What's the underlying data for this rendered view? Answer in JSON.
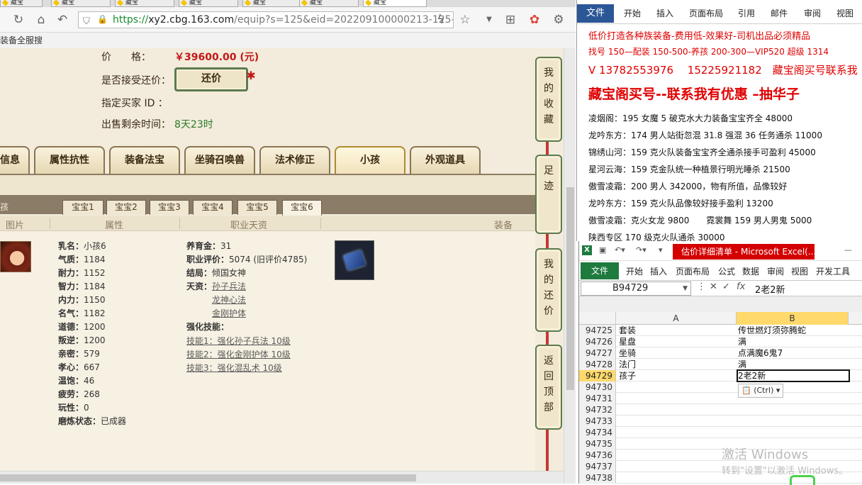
{
  "browser": {
    "tabs": [
      "藏宝",
      "藏宝",
      "藏宝",
      "藏宝",
      "藏宝",
      "藏宝",
      "藏宝"
    ],
    "url_https": "https://",
    "url_host": "xy2.cbg.163.com",
    "url_rest": "/equip?s=125&eid=202209100000213-125-",
    "bookmark": "装备全服搜"
  },
  "sale": {
    "price_label": "价　　格：",
    "price_value": "￥39600.00 (元)",
    "bargain_label": "是否接受还价：",
    "bargain_button": "还价",
    "buyer_label": "指定买家 ID ：",
    "remaining_label": "出售剩余时间：",
    "remaining_value": "8天23时"
  },
  "category_tabs": [
    "信息",
    "属性抗性",
    "装备法宝",
    "坐骑召唤兽",
    "法术修正",
    "小孩",
    "外观道具"
  ],
  "baby_tabs": [
    "宝宝1",
    "宝宝2",
    "宝宝3",
    "宝宝4",
    "宝宝5",
    "宝宝6"
  ],
  "band2_left": "孩",
  "headers": [
    "图片",
    "属性",
    "职业天资",
    "装备"
  ],
  "child": {
    "attrs": [
      {
        "k": "乳名：",
        "v": "小孩6"
      },
      {
        "k": "气质：",
        "v": "1184"
      },
      {
        "k": "耐力：",
        "v": "1152"
      },
      {
        "k": "智力：",
        "v": "1184"
      },
      {
        "k": "内力：",
        "v": "1150"
      },
      {
        "k": "名气：",
        "v": "1182"
      },
      {
        "k": "道德：",
        "v": "1200"
      },
      {
        "k": "叛逆：",
        "v": "1200"
      },
      {
        "k": "亲密：",
        "v": "579"
      },
      {
        "k": "孝心：",
        "v": "667"
      },
      {
        "k": "温饱：",
        "v": "46"
      },
      {
        "k": "疲劳：",
        "v": "268"
      },
      {
        "k": "玩性：",
        "v": "0"
      },
      {
        "k": "磨炼状态：",
        "v": "已成器"
      }
    ],
    "support_money": {
      "k": "养育金：",
      "v": "31"
    },
    "career_score": {
      "k": "职业评价：",
      "v": "5074 (旧评价4785)"
    },
    "ending": {
      "k": "结局：",
      "v": "倾国女神"
    },
    "talent_label": "天资：",
    "talents": [
      "孙子兵法",
      "龙神心法",
      "金刚护体"
    ],
    "skills_label": "强化技能：",
    "skills": [
      "技能1：强化孙子兵法 10级",
      "技能2：强化金刚护体 10级",
      "技能3：强化混乱术 10级"
    ]
  },
  "side_buttons": [
    [
      "我",
      "的",
      "收",
      "藏"
    ],
    [
      "足",
      "迹"
    ],
    [
      "我",
      "的",
      "还",
      "价"
    ],
    [
      "返",
      "回",
      "顶",
      "部"
    ]
  ],
  "word": {
    "menu": [
      "开始",
      "插入",
      "页面布局",
      "引用",
      "邮件",
      "审阅",
      "视图"
    ],
    "file": "文件",
    "lines": [
      {
        "t": "低价打造各种族装备-费用低-效果好-司机出品必须精品",
        "cls": "red"
      },
      {
        "t": "找号 150—配装 150-500-养孩 200-300—VIP520 超级 1314",
        "cls": "red"
      },
      {
        "t": "V 13782553976　 15225921182　藏宝阁买号联系我",
        "cls": "red"
      },
      {
        "t": "藏宝阁买号--联系我有优惠 –抽华子",
        "cls": "red"
      },
      {
        "t": "凌烟阁：195 女魔 5 破克水大力装备宝宝齐全 48000",
        "cls": ""
      },
      {
        "t": "龙吟东方：174 男人站街忽混 31.8 强混 36 任务通杀 11000",
        "cls": ""
      },
      {
        "t": "锦绣山河：159 克火队装备宝宝齐全通杀接手可盈利 45000",
        "cls": ""
      },
      {
        "t": "星河云海：159 克金队统一种植景行明光睡杀 21500",
        "cls": ""
      },
      {
        "t": "傲雪凌霜：200 男人 342000，物有所值，品像较好",
        "cls": ""
      },
      {
        "t": "龙吟东方：159 克火队品像较好接手盈利 13200",
        "cls": ""
      },
      {
        "t": "傲雪凌霜：克火女龙 9800　　霓裳舞 159 男人男鬼 5000",
        "cls": ""
      },
      {
        "t": "陕西专区 170 级克火队通杀 30000",
        "cls": ""
      }
    ]
  },
  "excel": {
    "title": "估价详细清单 - Microsoft Excel(...",
    "file": "文件",
    "menu": [
      "开始",
      "插入",
      "页面布局",
      "公式",
      "数据",
      "审阅",
      "视图",
      "开发工具"
    ],
    "namebox": "B94729",
    "formula_value": "2老2新",
    "col_a": "A",
    "col_b": "B",
    "rows": [
      {
        "n": "94725",
        "a": "套装",
        "b": "传世燃灯须弥腾蛇"
      },
      {
        "n": "94726",
        "a": "星盘",
        "b": "满"
      },
      {
        "n": "94727",
        "a": "坐骑",
        "b": "点满魔6鬼7"
      },
      {
        "n": "94728",
        "a": "法门",
        "b": "满"
      },
      {
        "n": "94729",
        "a": "孩子",
        "b": "2老2新"
      },
      {
        "n": "94730",
        "a": "",
        "b": ""
      },
      {
        "n": "94731",
        "a": "",
        "b": ""
      },
      {
        "n": "94732",
        "a": "",
        "b": ""
      },
      {
        "n": "94733",
        "a": "",
        "b": ""
      },
      {
        "n": "94734",
        "a": "",
        "b": ""
      },
      {
        "n": "94735",
        "a": "",
        "b": ""
      },
      {
        "n": "94736",
        "a": "",
        "b": ""
      },
      {
        "n": "94737",
        "a": "",
        "b": ""
      },
      {
        "n": "94738",
        "a": "",
        "b": ""
      }
    ],
    "selected_row": "94729",
    "paste_label": "(Ctrl)"
  },
  "watermark": {
    "line1": "激活 Windows",
    "line2": "转到\"设置\"以激活 Windows。"
  }
}
